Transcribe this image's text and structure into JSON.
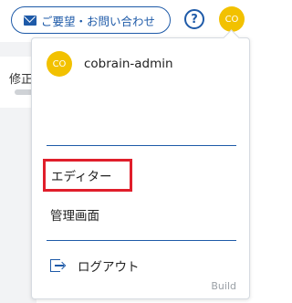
{
  "header": {
    "contact_label": "ご要望・お問い合わせ",
    "help_symbol": "?",
    "avatar_initials": "CO"
  },
  "background": {
    "partial_text": "修正"
  },
  "user_menu": {
    "avatar_initials": "CO",
    "username": "cobrain-admin",
    "items": [
      {
        "label": "エディター",
        "highlighted": true
      },
      {
        "label": "管理画面"
      }
    ],
    "logout_label": "ログアウト",
    "build_label": "Build"
  },
  "colors": {
    "accent": "#1e5aa8",
    "avatar": "#f2c100",
    "highlight_border": "#e01e2b"
  }
}
